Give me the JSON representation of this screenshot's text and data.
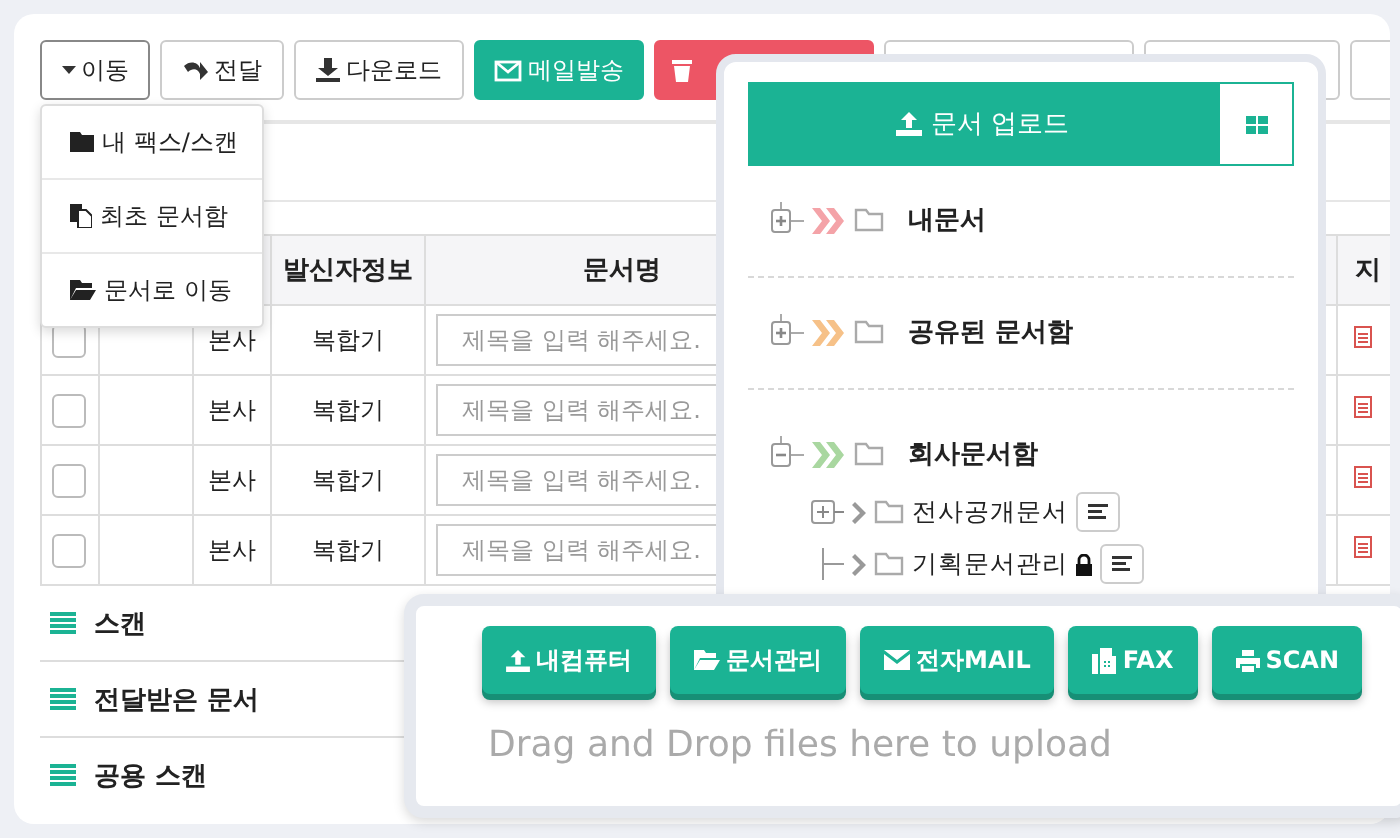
{
  "toolbar": {
    "buttons": [
      {
        "kind": "move",
        "label": "이동"
      },
      {
        "kind": "forward",
        "label": "전달"
      },
      {
        "kind": "download",
        "label": "다운로드"
      },
      {
        "kind": "mail",
        "label": "메일발송"
      },
      {
        "kind": "delete"
      },
      {
        "kind": "blank"
      },
      {
        "kind": "blank"
      },
      {
        "kind": "blank"
      }
    ]
  },
  "move_menu": {
    "items": [
      {
        "kind": "folder",
        "label": "내 팩스/스캔"
      },
      {
        "kind": "file",
        "label": "최초 문서함"
      },
      {
        "kind": "folder-open",
        "label": "문서로 이동"
      }
    ]
  },
  "table": {
    "columns": [
      "발신자정보",
      "문서명",
      "지"
    ],
    "rows": [
      {
        "checked": false,
        "office": "본사",
        "source": "복합기",
        "placeholder": "제목을 입력 해주세요."
      },
      {
        "checked": false,
        "office": "본사",
        "source": "복합기",
        "placeholder": "제목을 입력 해주세요."
      },
      {
        "checked": false,
        "office": "본사",
        "source": "복합기",
        "placeholder": "제목을 입력 해주세요."
      },
      {
        "checked": false,
        "office": "본사",
        "source": "복합기",
        "placeholder": "제목을 입력 해주세요."
      }
    ]
  },
  "nav": [
    {
      "label": "스캔"
    },
    {
      "label": "전달받은 문서"
    },
    {
      "label": "공용 스캔"
    }
  ],
  "tree": {
    "upload_button": "문서 업로드",
    "items": [
      {
        "label": "내문서",
        "color": "#f4a3a8",
        "expanded": false
      },
      {
        "label": "공유된 문서함",
        "color": "#f6c188",
        "expanded": false
      },
      {
        "label": "회사문서함",
        "color": "#a9d7a0",
        "expanded": true,
        "children": [
          {
            "kind": "branch",
            "label": "전사공개문서",
            "locked": false
          },
          {
            "kind": "leaf",
            "label": "기획문서관리",
            "locked": true
          }
        ]
      }
    ]
  },
  "upload_panel": {
    "buttons": [
      {
        "kind": "computer",
        "label": "내컴퓨터"
      },
      {
        "kind": "folder",
        "label": "문서관리"
      },
      {
        "kind": "mail",
        "label": "전자MAIL"
      },
      {
        "kind": "fax",
        "label": "FAX"
      },
      {
        "kind": "print",
        "label": "SCAN"
      }
    ],
    "drop_hint": "Drag and Drop files here to upload"
  }
}
